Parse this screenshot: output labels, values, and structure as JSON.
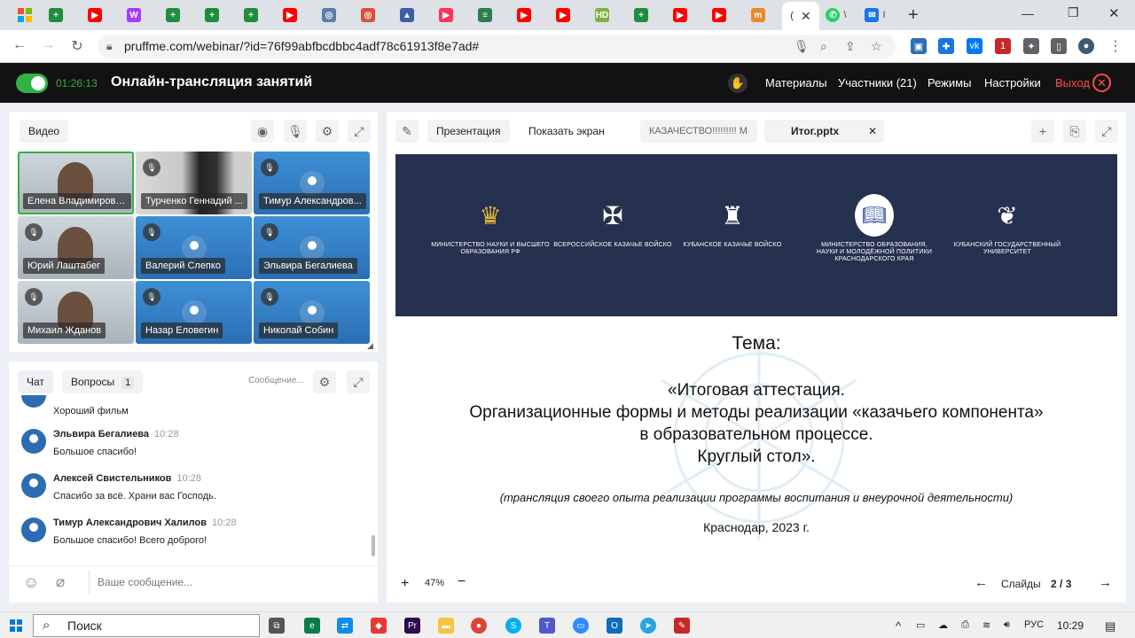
{
  "browser": {
    "tabs": [
      {
        "icon": "sheets-icon",
        "color": "#1e8e3e",
        "glyph": "+"
      },
      {
        "icon": "youtube-icon",
        "color": "#ff0000",
        "glyph": "▶"
      },
      {
        "icon": "wb-icon",
        "color": "#a73afd",
        "glyph": "W"
      },
      {
        "icon": "sheets-icon",
        "color": "#1e8e3e",
        "glyph": "+"
      },
      {
        "icon": "sheets-icon",
        "color": "#1e8e3e",
        "glyph": "+"
      },
      {
        "icon": "sheets-icon",
        "color": "#1e8e3e",
        "glyph": "+"
      },
      {
        "icon": "youtube-icon",
        "color": "#ff0000",
        "glyph": "▶"
      },
      {
        "icon": "site-icon",
        "color": "#5b7fa6",
        "glyph": "◎"
      },
      {
        "icon": "site-icon",
        "color": "#d9533b",
        "glyph": "◎"
      },
      {
        "icon": "site-icon",
        "color": "#3b5ea8",
        "glyph": "▲"
      },
      {
        "icon": "youtube-icon",
        "color": "#ff3355",
        "glyph": "▶"
      },
      {
        "icon": "site-icon",
        "color": "#2e7d4f",
        "glyph": "≡"
      },
      {
        "icon": "youtube-icon",
        "color": "#ff0000",
        "glyph": "▶"
      },
      {
        "icon": "youtube-icon",
        "color": "#ff0000",
        "glyph": "▶"
      },
      {
        "icon": "hd-icon",
        "color": "#7cb342",
        "glyph": "HD"
      },
      {
        "icon": "sheets-icon",
        "color": "#1e8e3e",
        "glyph": "+"
      },
      {
        "icon": "youtube-icon",
        "color": "#ff0000",
        "glyph": "▶"
      },
      {
        "icon": "youtube-icon",
        "color": "#ff0000",
        "glyph": "▶"
      },
      {
        "icon": "site-icon",
        "color": "#e8892c",
        "glyph": "m"
      }
    ],
    "active_tab_label": "(",
    "whatsapp_tab": "\\",
    "mail_tab": "I",
    "new_tab": "+",
    "url": "pruffme.com/webinar/?id=76f99abfbcdbbc4adf78c61913f8e7ad#",
    "ext_badge": "1"
  },
  "app": {
    "timer": "01:26:13",
    "title": "Онлайн-трансляция занятий",
    "menu": {
      "materials": "Материалы",
      "participants": "Участники (21)",
      "modes": "Режимы",
      "settings": "Настройки",
      "exit": "Выход"
    }
  },
  "video": {
    "label": "Видео",
    "participants": [
      {
        "name": "Елена Владимировна...",
        "type": "photo",
        "muted": false
      },
      {
        "name": "Турченко Геннадий ...",
        "type": "photo-dark",
        "muted": true
      },
      {
        "name": "Тимур Александров...",
        "type": "avatar",
        "muted": true
      },
      {
        "name": "Юрий Лаштабег",
        "type": "photo",
        "muted": true
      },
      {
        "name": "Валерий Слепко",
        "type": "avatar",
        "muted": true
      },
      {
        "name": "Эльвира Бегалиева",
        "type": "avatar",
        "muted": true
      },
      {
        "name": "Михаил Жданов",
        "type": "photo",
        "muted": true
      },
      {
        "name": "Назар Еловегин",
        "type": "avatar",
        "muted": true
      },
      {
        "name": "Николай Собин",
        "type": "avatar",
        "muted": true
      }
    ]
  },
  "chat": {
    "tab_chat": "Чат",
    "tab_questions": "Вопросы",
    "questions_count": "1",
    "messages_label": "Сообщение...",
    "first_partial": "Хороший фильм",
    "messages": [
      {
        "author": "Эльвира Бегалиева",
        "time": "10:28",
        "text": "Большое спасибо!"
      },
      {
        "author": "Алексей Свистельников",
        "time": "10:28",
        "text": "Спасибо за всё. Храни вас Господь."
      },
      {
        "author": "Тимур Александрович Халилов",
        "time": "10:28",
        "text": "Большое спасибо! Всего доброго!"
      }
    ],
    "input_placeholder": "Ваше сообщение..."
  },
  "presentation": {
    "tab_presentation": "Презентация",
    "tab_share": "Показать экран",
    "file_tab_1": "КАЗАЧЕСТВО!!!!!!!!! М",
    "file_tab_2": "Итог.pptx",
    "zoom": "47%",
    "slides_label": "Слайды",
    "slide_current": "2",
    "slide_sep": "/",
    "slide_total": "3",
    "slide": {
      "emblems": [
        "МИНИСТЕРСТВО НАУКИ И ВЫСШЕГО ОБРАЗОВАНИЯ РФ",
        "ВСЕРОССИЙСКОЕ КАЗАЧЬЕ ВОЙСКО",
        "КУБАНСКОЕ КАЗАЧЬЕ ВОЙСКО",
        "МИНИСТЕРСТВО ОБРАЗОВАНИЯ, НАУКИ И МОЛОДЁЖНОЙ ПОЛИТИКИ КРАСНОДАРСКОГО КРАЯ",
        "КУБАНСКИЙ ГОСУДАРСТВЕННЫЙ УНИВЕРСИТЕТ"
      ],
      "theme": "Тема:",
      "line1": "«Итоговая аттестация.",
      "line2": "Организационные формы и методы реализации «казачьего компонента»",
      "line3": "в образовательном процессе.",
      "line4": "Круглый стол».",
      "subtitle": "(трансляция своего опыта реализации программы воспитания и внеурочной деятельности)",
      "city": "Краснодар, 2023 г."
    }
  },
  "taskbar": {
    "search": "Поиск",
    "lang": "РУС",
    "time": "10:29"
  }
}
